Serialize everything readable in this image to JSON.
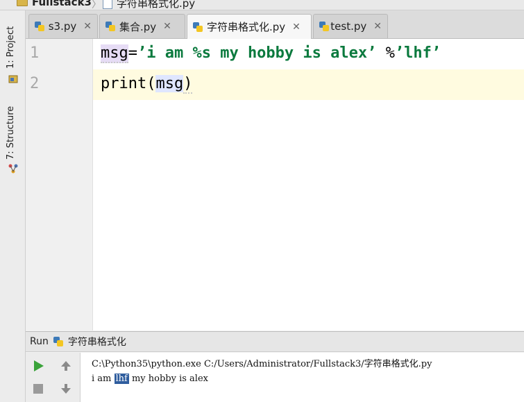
{
  "breadcrumb": {
    "project": "Fullstack3",
    "file": "字符串格式化.py"
  },
  "left_strip": {
    "project_tab": "1: Project",
    "structure_tab": "7: Structure"
  },
  "tabs": [
    {
      "label": "s3.py",
      "active": false
    },
    {
      "label": "集合.py",
      "active": false
    },
    {
      "label": "字符串格式化.py",
      "active": true
    },
    {
      "label": "test.py",
      "active": false
    }
  ],
  "editor": {
    "line_numbers": [
      "1",
      "2"
    ],
    "line1": {
      "var": "msg",
      "eq": "=",
      "string": "’i am %s my hobby is alex’",
      "op": " %",
      "string2": "’lhf’"
    },
    "line2": {
      "func": "print",
      "open": "(",
      "arg": "msg",
      "close": ")"
    }
  },
  "run": {
    "label": "Run",
    "config": "字符串格式化",
    "command": "C:\\Python35\\python.exe C:/Users/Administrator/Fullstack3/字符串格式化.py",
    "output_pre": "i am ",
    "output_sel": "lhf",
    "output_post": " my hobby is alex"
  },
  "colors": {
    "string": "#0b7a3e",
    "run_green": "#3aa33a",
    "selection": "#2f5d9e"
  }
}
